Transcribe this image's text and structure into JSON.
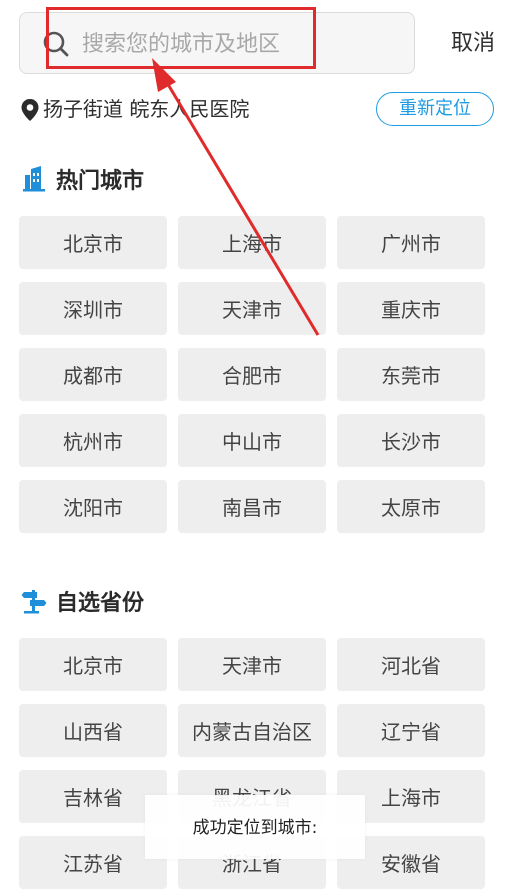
{
  "search": {
    "placeholder": "搜索您的城市及地区",
    "cancel_label": "取消"
  },
  "location": {
    "text": "扬子街道 皖东人民医院",
    "relocate_label": "重新定位"
  },
  "hot_cities": {
    "title": "热门城市",
    "items": [
      "北京市",
      "上海市",
      "广州市",
      "深圳市",
      "天津市",
      "重庆市",
      "成都市",
      "合肥市",
      "东莞市",
      "杭州市",
      "中山市",
      "长沙市",
      "沈阳市",
      "南昌市",
      "太原市"
    ]
  },
  "provinces": {
    "title": "自选省份",
    "items": [
      "北京市",
      "天津市",
      "河北省",
      "山西省",
      "内蒙古自治区",
      "辽宁省",
      "吉林省",
      "黑龙江省",
      "上海市",
      "江苏省",
      "浙江省",
      "安徽省"
    ]
  },
  "toast": {
    "text": "成功定位到城市:"
  },
  "colors": {
    "accent": "#1e9be3",
    "highlight": "#df2b2b",
    "cell_bg": "#eeeeee"
  },
  "icons": {
    "search": "search-icon",
    "location": "location-pin-icon",
    "hot": "building-icon",
    "province": "signpost-icon"
  }
}
